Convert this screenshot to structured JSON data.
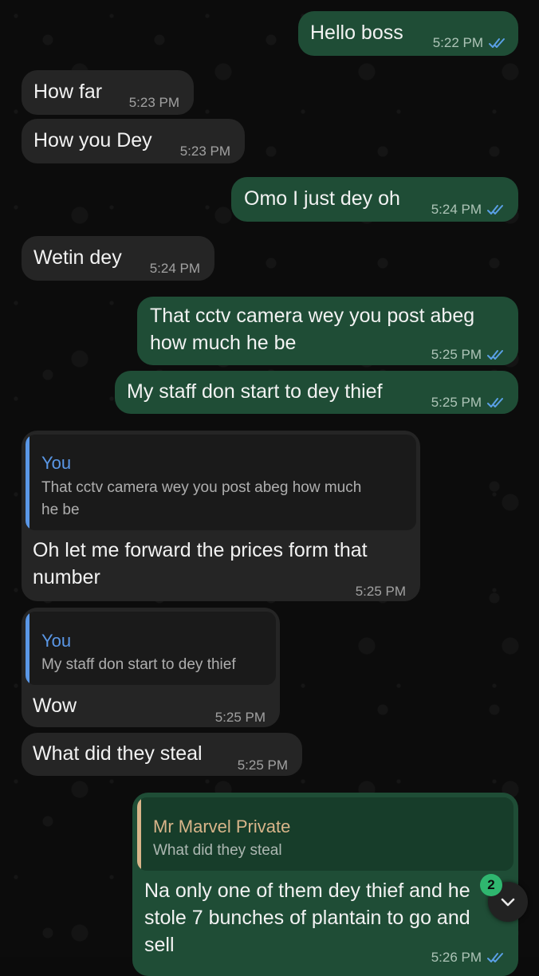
{
  "colors": {
    "incoming_bubble": "#252525",
    "outgoing_bubble": "#1f4d36",
    "read_ticks": "#5aa0e6",
    "quote_you": "#5a97e6",
    "quote_contact": "#d9b58a",
    "unread_badge": "#2fb66f"
  },
  "messages": [
    {
      "text": "Hello boss",
      "time": "5:22 PM",
      "direction": "out",
      "status": "read"
    },
    {
      "text": "How far",
      "time": "5:23 PM",
      "direction": "in"
    },
    {
      "text": "How you Dey",
      "time": "5:23 PM",
      "direction": "in"
    },
    {
      "text": "Omo I just dey oh",
      "time": "5:24 PM",
      "direction": "out",
      "status": "read"
    },
    {
      "text": "Wetin dey",
      "time": "5:24 PM",
      "direction": "in"
    },
    {
      "line1": "That cctv camera wey you post abeg",
      "line2": "how much he be",
      "time": "5:25 PM",
      "direction": "out",
      "status": "read"
    },
    {
      "text": "My staff don start to dey thief",
      "time": "5:25 PM",
      "direction": "out",
      "status": "read"
    },
    {
      "quote_author": "You",
      "quote_line1": "That cctv camera wey you post abeg how much",
      "quote_line2": "he be",
      "line1": "Oh let me forward the prices form that",
      "line2": "number",
      "time": "5:25 PM",
      "direction": "in"
    },
    {
      "quote_author": "You",
      "quote_text": "My staff don start to dey thief",
      "text": "Wow",
      "time": "5:25 PM",
      "direction": "in"
    },
    {
      "text": "What did they steal",
      "time": "5:25 PM",
      "direction": "in"
    },
    {
      "quote_author": "Mr Marvel Private",
      "quote_text": "What did they steal",
      "line1": "Na only one of them dey thief and he",
      "line2": "stole 7 bunches of plantain to go and",
      "line3": "sell",
      "time": "5:26 PM",
      "direction": "out",
      "status": "read"
    }
  ],
  "scroll_button": {
    "icon": "chevron-down-icon",
    "unread_count": "2"
  }
}
